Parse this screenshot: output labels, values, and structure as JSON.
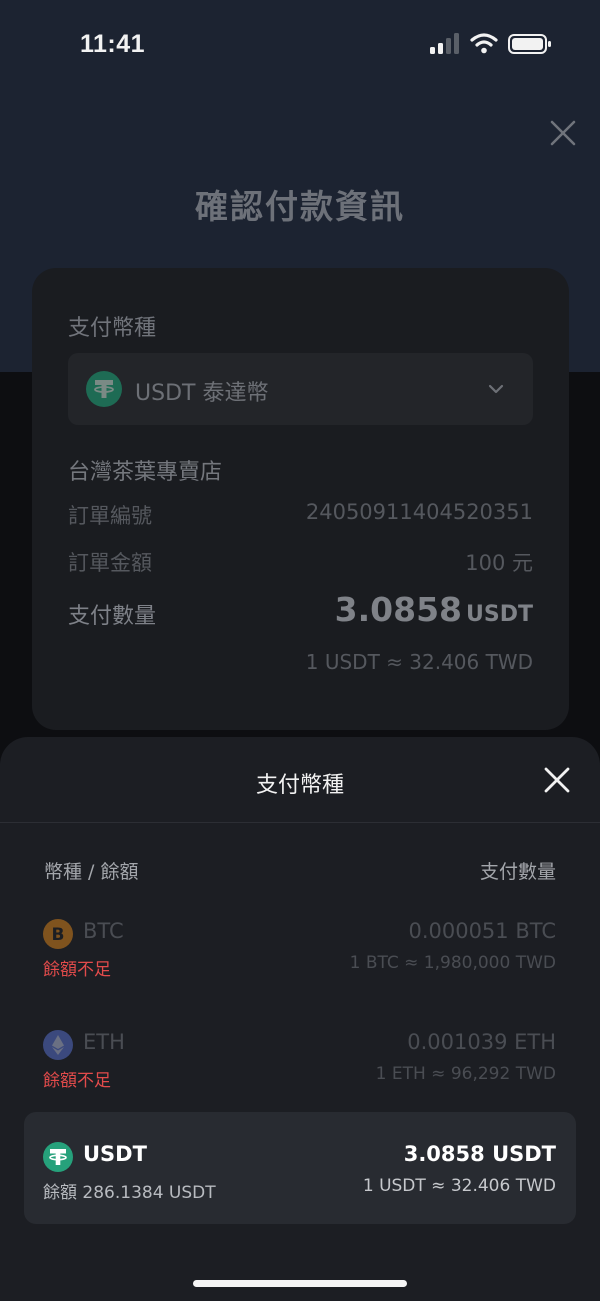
{
  "status_bar": {
    "time": "11:41"
  },
  "page": {
    "title": "確認付款資訊"
  },
  "payment": {
    "currency_label": "支付幣種",
    "currency_selected": "USDT 泰達幣",
    "merchant": "台灣茶葉專賣店",
    "order_number_label": "訂單編號",
    "order_number": "24050911404520351",
    "order_amount_label": "訂單金額",
    "order_amount": "100 元",
    "pay_quantity_label": "支付數量",
    "pay_quantity": "3.0858",
    "pay_unit": "USDT",
    "rate": "1 USDT ≈ 32.406 TWD"
  },
  "sheet": {
    "title": "支付幣種",
    "col_left": "幣種 / 餘額",
    "col_right": "支付數量",
    "coins": [
      {
        "name": "BTC",
        "status": "餘額不足",
        "amount": "0.000051 BTC",
        "rate": "1 BTC ≈ 1,980,000 TWD",
        "icon": "bitcoin-icon",
        "color": "#f7931a"
      },
      {
        "name": "ETH",
        "status": "餘額不足",
        "amount": "0.001039 ETH",
        "rate": "1 ETH ≈ 96,292 TWD",
        "icon": "ethereum-icon",
        "color": "#627eea"
      },
      {
        "name": "USDT",
        "status": "餘額 286.1384 USDT",
        "amount": "3.0858 USDT",
        "rate": "1 USDT ≈ 32.406 TWD",
        "icon": "tether-icon",
        "color": "#26a17b"
      }
    ]
  }
}
